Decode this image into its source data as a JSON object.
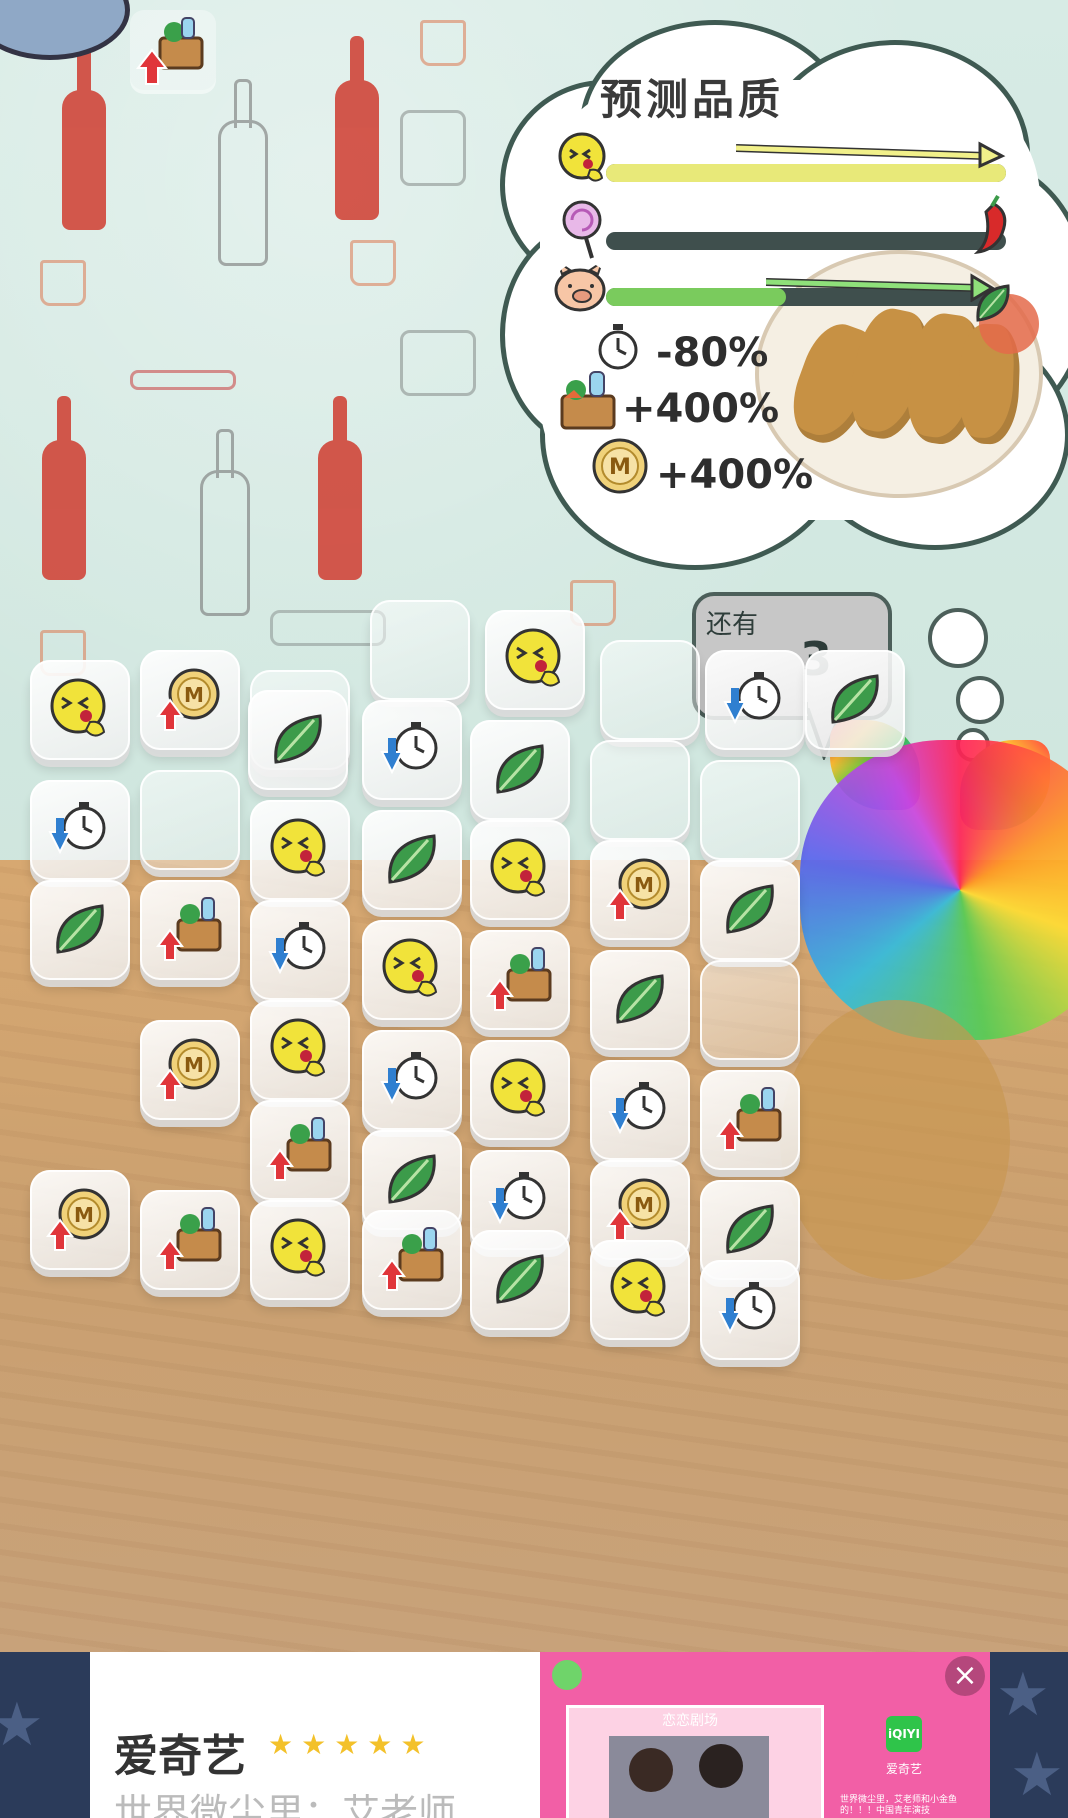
{
  "quality_panel": {
    "title": "预测品质",
    "bars": [
      {
        "icon": "yummy-face-icon",
        "fill": 1.0,
        "color": "#e8e979"
      },
      {
        "icon": "lollipop-icon",
        "fill": 0.0,
        "color": "#d0d35a",
        "marker_icon": "chili-icon"
      },
      {
        "icon": "pig-icon",
        "fill": 0.45,
        "color": "#7acb5d",
        "marker_icon": "leaf-icon"
      }
    ],
    "time_bonus": "-80%",
    "ingredient_bonus": "+400%",
    "coin_bonus": "+400%"
  },
  "remaining": {
    "label": "还有",
    "value": "3"
  },
  "board": {
    "tiles": [
      {
        "icon": "empty"
      },
      {
        "icon": "empty"
      },
      {
        "icon": "yummy-face"
      },
      {
        "icon": "empty"
      },
      {
        "icon": "timer-down"
      },
      {
        "icon": "leaf"
      },
      {
        "icon": "yummy-face"
      },
      {
        "icon": "coin-up"
      },
      {
        "icon": "leaf"
      },
      {
        "icon": "timer-down"
      },
      {
        "icon": "leaf"
      },
      {
        "icon": "empty"
      },
      {
        "icon": "empty"
      },
      {
        "icon": "timer-down"
      },
      {
        "icon": "empty"
      },
      {
        "icon": "yummy-face"
      },
      {
        "icon": "leaf"
      },
      {
        "icon": "yummy-face"
      },
      {
        "icon": "coin-up"
      },
      {
        "icon": "leaf"
      },
      {
        "icon": "leaf"
      },
      {
        "icon": "basket-up"
      },
      {
        "icon": "timer-down"
      },
      {
        "icon": "yummy-face"
      },
      {
        "icon": "basket-up"
      },
      {
        "icon": "leaf"
      },
      {
        "icon": "empty"
      },
      {
        "icon": "coin-up"
      },
      {
        "icon": "yummy-face"
      },
      {
        "icon": "timer-down"
      },
      {
        "icon": "yummy-face"
      },
      {
        "icon": "timer-down"
      },
      {
        "icon": "basket-up"
      },
      {
        "icon": "basket-up"
      },
      {
        "icon": "leaf"
      },
      {
        "icon": "timer-down"
      },
      {
        "icon": "coin-up"
      },
      {
        "icon": "leaf"
      },
      {
        "icon": "coin-up"
      },
      {
        "icon": "basket-up"
      },
      {
        "icon": "yummy-face"
      },
      {
        "icon": "basket-up"
      },
      {
        "icon": "leaf"
      },
      {
        "icon": "yummy-face"
      },
      {
        "icon": "timer-down"
      }
    ]
  },
  "ad": {
    "app_name": "爱奇艺",
    "rating_stars": "★★★★★",
    "subtitle": "世界微尘里：艾老师",
    "close_symbol": "×",
    "app_badge": "iQIYI",
    "app_badge_label": "爱奇艺",
    "shot_label": "恋恋剧场",
    "mini_text": "世界微尘里，艾老师和小金鱼的！！！中国青年演技"
  },
  "colors": {
    "cloud_outline": "#3f5a52",
    "accent_yellow": "#f1e33a",
    "leaf_green": "#3c9b4a",
    "arrow_red": "#e0353a",
    "arrow_blue": "#2f7fd0",
    "ad_pink": "#f25fa6"
  }
}
